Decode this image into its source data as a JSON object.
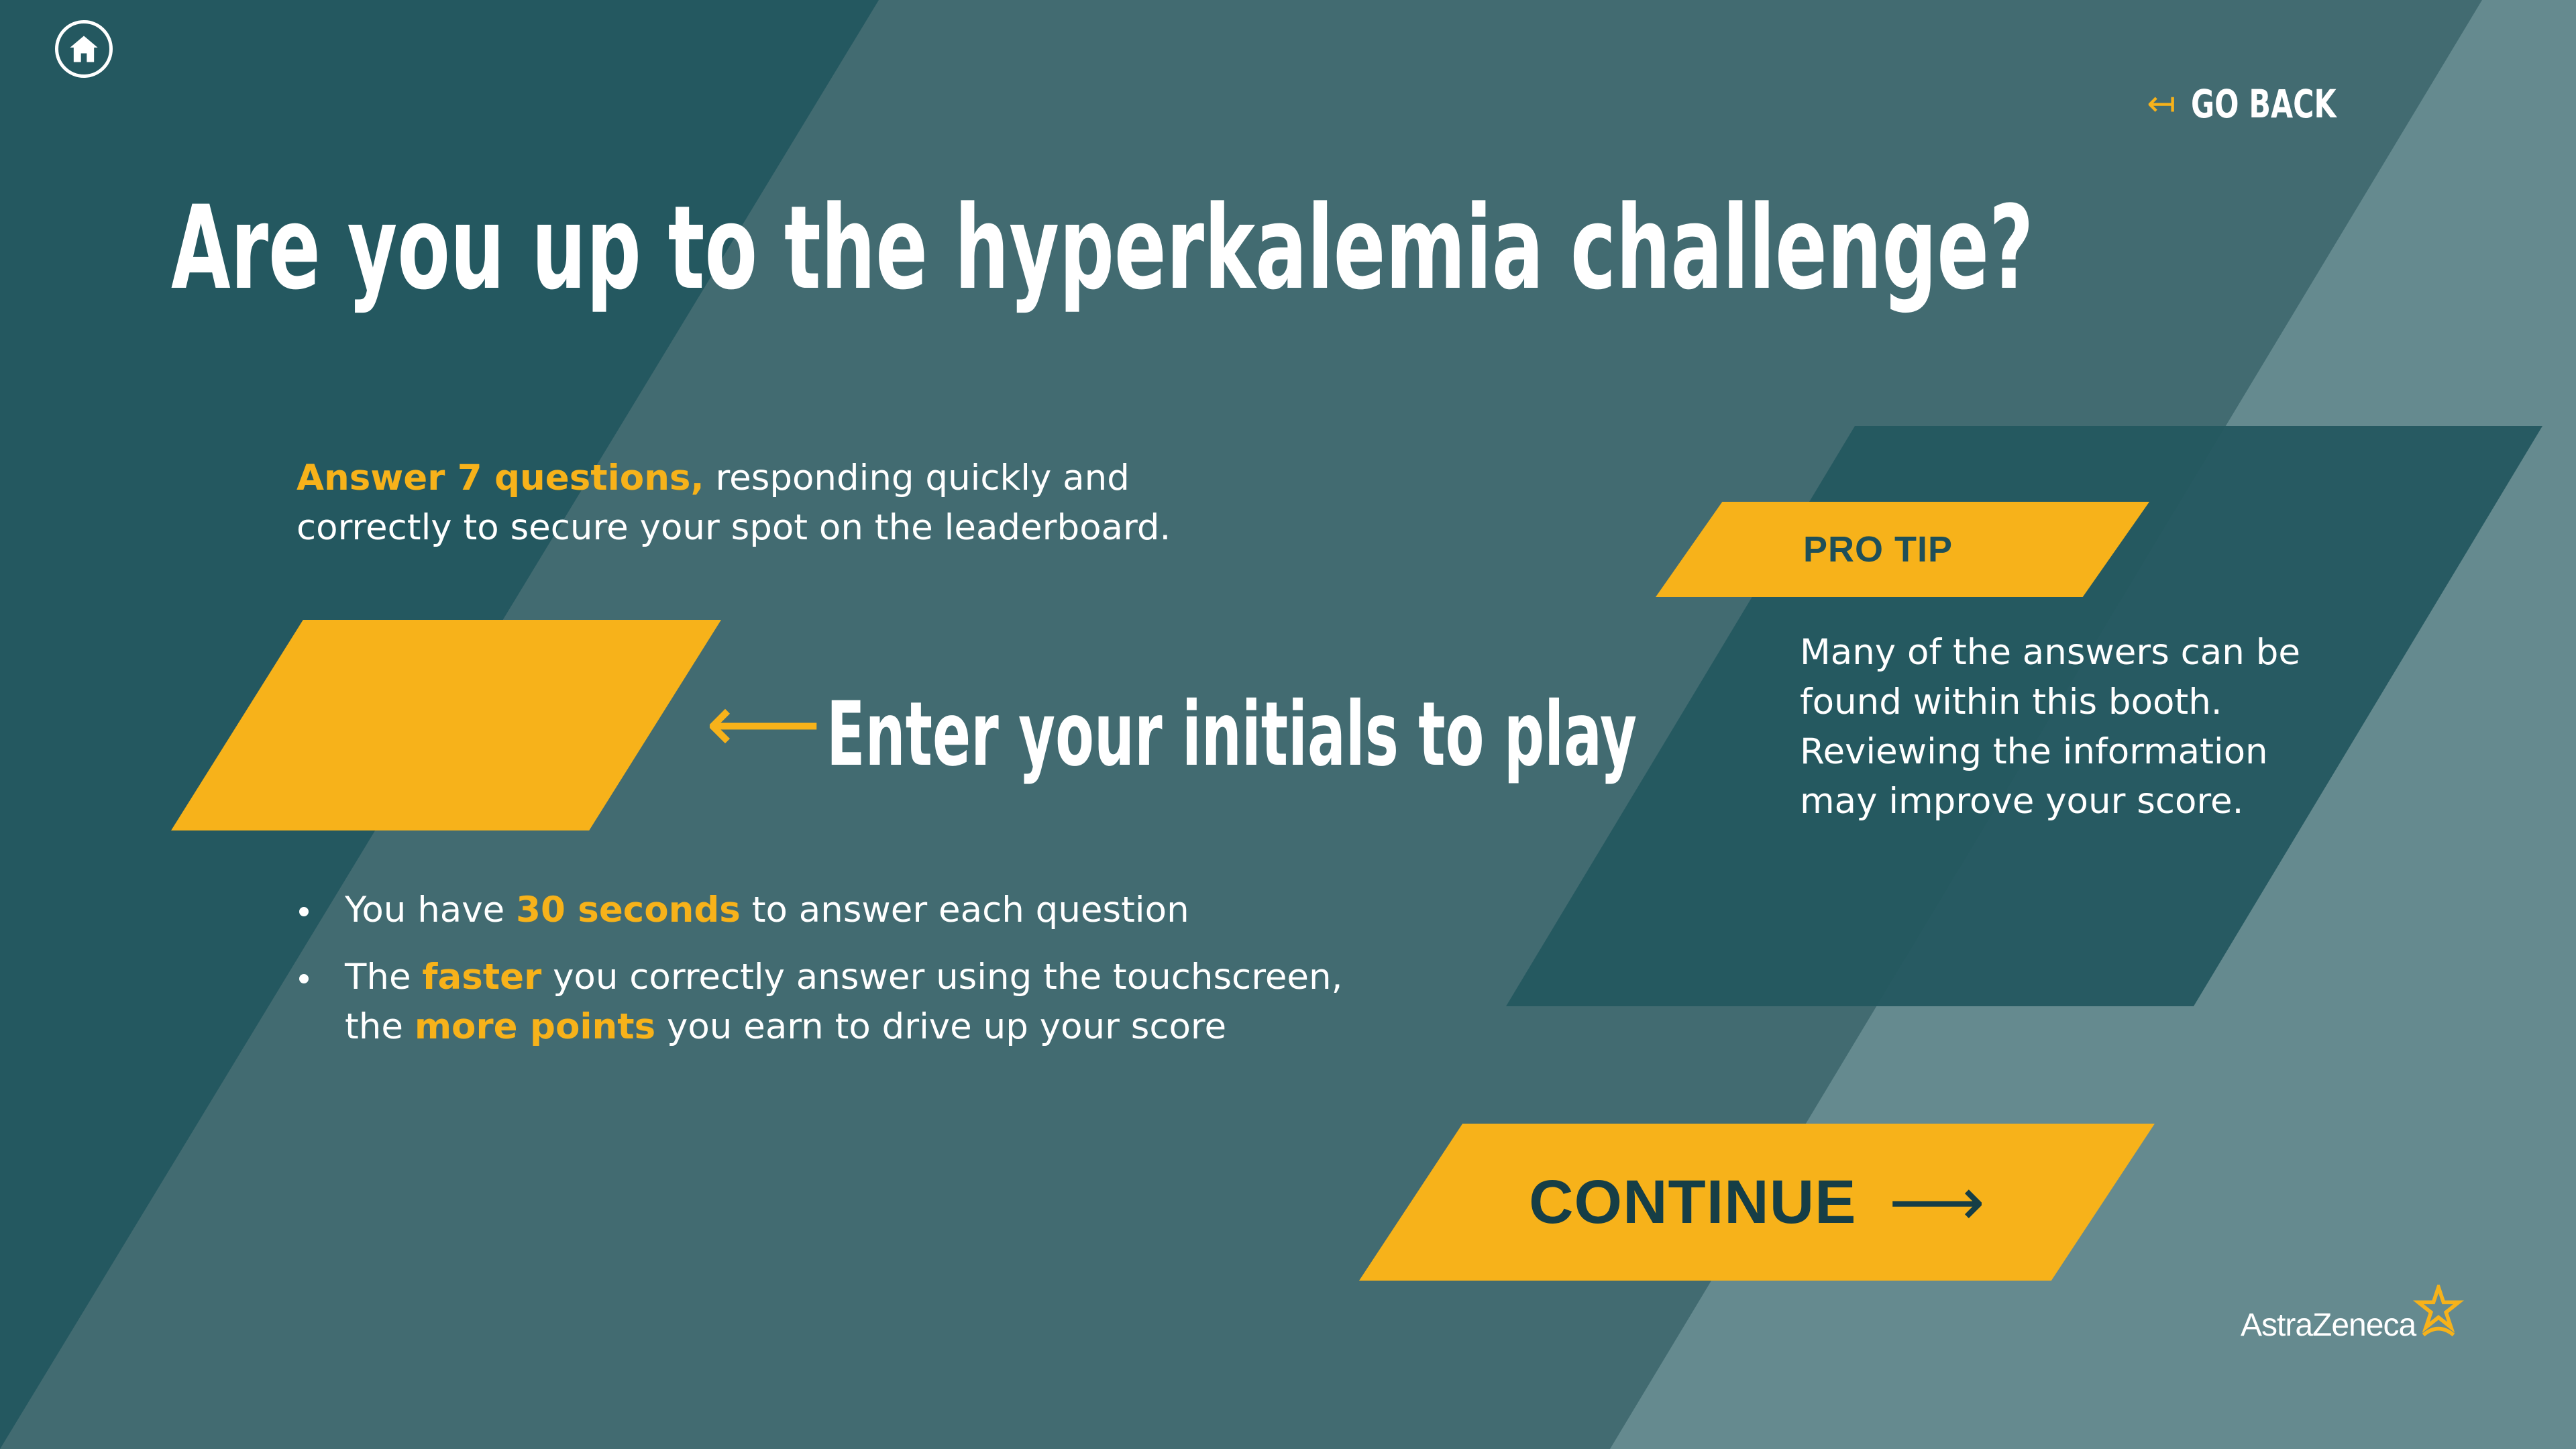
{
  "navigation": {
    "home_icon": "home-icon",
    "go_back_icon": "return-arrow-icon",
    "go_back_label": "GO BACK"
  },
  "title": "Are you up to the hyperkalemia challenge?",
  "intro": {
    "highlight": "Answer 7 questions,",
    "text": " responding quickly and correctly to secure your spot on the leaderboard."
  },
  "initials": {
    "placeholder": "",
    "value": "",
    "label": "Enter your initials to play",
    "arrow_icon": "left-arrow-icon"
  },
  "rules": [
    {
      "pre": "You have ",
      "highlight": "30 seconds",
      "post": " to answer each question"
    },
    {
      "pre": "The ",
      "highlight": "faster",
      "mid": " you correctly answer using the touchscreen, the ",
      "highlight2": "more points",
      "post": " you earn to drive up your score"
    }
  ],
  "pro_tip": {
    "label": "PRO TIP",
    "text": "Many of the answers can be found within this booth. Reviewing the information may improve your score."
  },
  "continue": {
    "label": "CONTINUE",
    "arrow_icon": "right-arrow-icon"
  },
  "brand": {
    "name": "AstraZeneca",
    "logo_icon": "astrazeneca-logo-icon"
  },
  "colors": {
    "accent": "#f7b21a",
    "background": "#426b71",
    "dark_panel": "#245860",
    "light_panel": "#658a8f",
    "dark_text": "#163e46"
  }
}
